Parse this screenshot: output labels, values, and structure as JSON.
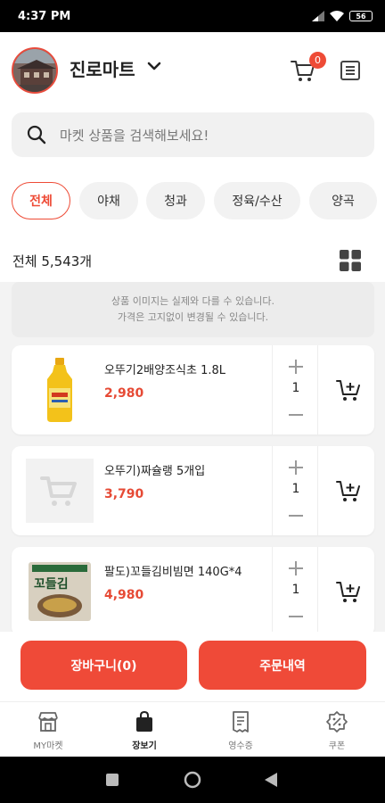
{
  "status": {
    "time": "4:37 PM",
    "battery": "56"
  },
  "header": {
    "store_name": "진로마트",
    "cart_count": "0"
  },
  "search": {
    "placeholder": "마켓 상품을 검색해보세요!"
  },
  "categories": [
    "전체",
    "야채",
    "청과",
    "정육/수산",
    "양곡"
  ],
  "active_category": "전체",
  "listing": {
    "count_label": "전체 5,543개"
  },
  "notice": {
    "line1": "상품 이미지는 실제와 다를 수 있습니다.",
    "line2": "가격은 고지없이 변경될 수 있습니다."
  },
  "products": [
    {
      "name": "오뚜기2배양조식초 1.8L",
      "price": "2,980",
      "qty": "1",
      "image": "vinegar-bottle"
    },
    {
      "name": "오뚜기)짜슐랭 5개입",
      "price": "3,790",
      "qty": "1",
      "image": "placeholder-cart"
    },
    {
      "name": "팔도)꼬들김비빔면 140G*4",
      "price": "4,980",
      "qty": "1",
      "image": "noodle-pack",
      "package_text": "꼬들김"
    }
  ],
  "actions": {
    "cart_button": "장바구니(0)",
    "order_button": "주문내역"
  },
  "tabs": [
    {
      "label": "MY마켓",
      "icon": "store-icon"
    },
    {
      "label": "장보기",
      "icon": "shopping-bag-icon"
    },
    {
      "label": "영수증",
      "icon": "receipt-icon"
    },
    {
      "label": "쿠폰",
      "icon": "coupon-icon"
    }
  ],
  "active_tab": "장보기",
  "colors": {
    "accent": "#ef4a38",
    "price": "#e64a35",
    "chip_bg": "#f2f2f2"
  }
}
